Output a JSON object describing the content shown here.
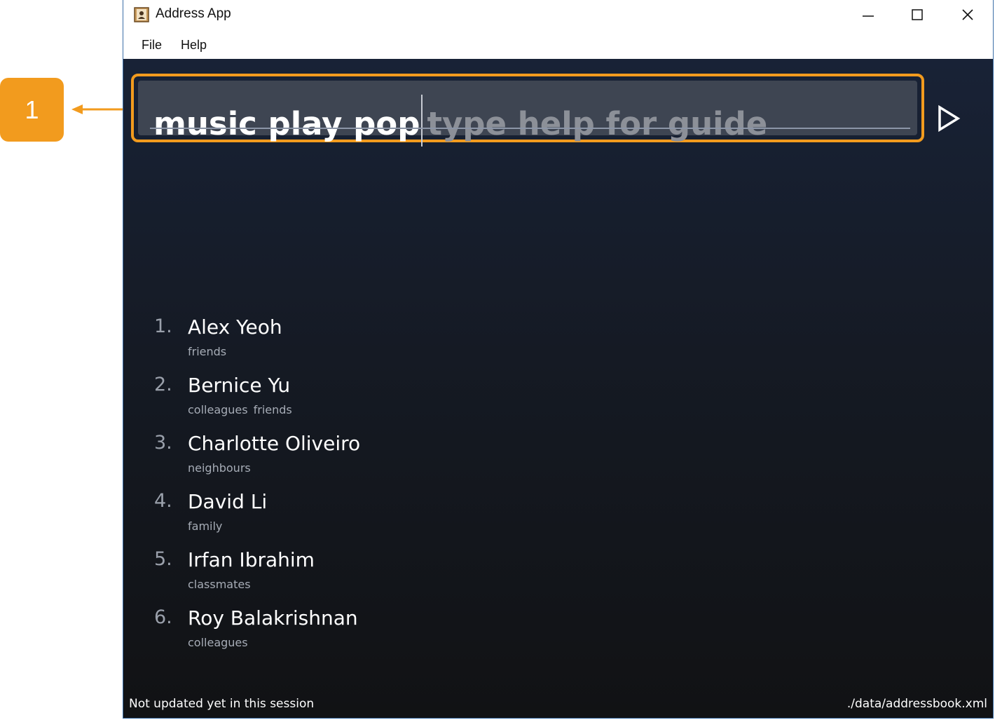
{
  "callout": {
    "label": "1",
    "color": "#f29b1e"
  },
  "window": {
    "title": "Address App",
    "icon": "address-book-icon",
    "controls": [
      "minimize-icon",
      "maximize-icon",
      "close-icon"
    ]
  },
  "menu": {
    "items": [
      {
        "label": "File"
      },
      {
        "label": "Help"
      }
    ]
  },
  "command": {
    "value": "music play pop",
    "placeholder": "type help for guide",
    "submit_icon": "play-triangle-icon"
  },
  "persons": [
    {
      "index": "1.",
      "name": "Alex Yeoh",
      "tags": [
        "friends"
      ]
    },
    {
      "index": "2.",
      "name": "Bernice Yu",
      "tags": [
        "colleagues",
        "friends"
      ]
    },
    {
      "index": "3.",
      "name": "Charlotte Oliveiro",
      "tags": [
        "neighbours"
      ]
    },
    {
      "index": "4.",
      "name": "David Li",
      "tags": [
        "family"
      ]
    },
    {
      "index": "5.",
      "name": "Irfan Ibrahim",
      "tags": [
        "classmates"
      ]
    },
    {
      "index": "6.",
      "name": "Roy Balakrishnan",
      "tags": [
        "colleagues"
      ]
    }
  ],
  "status": {
    "sync": "Not updated yet in this session",
    "file_path": "./data/addressbook.xml"
  },
  "colors": {
    "accent": "#f29b1e",
    "background": "#151a24",
    "command_field": "#3e4552"
  }
}
